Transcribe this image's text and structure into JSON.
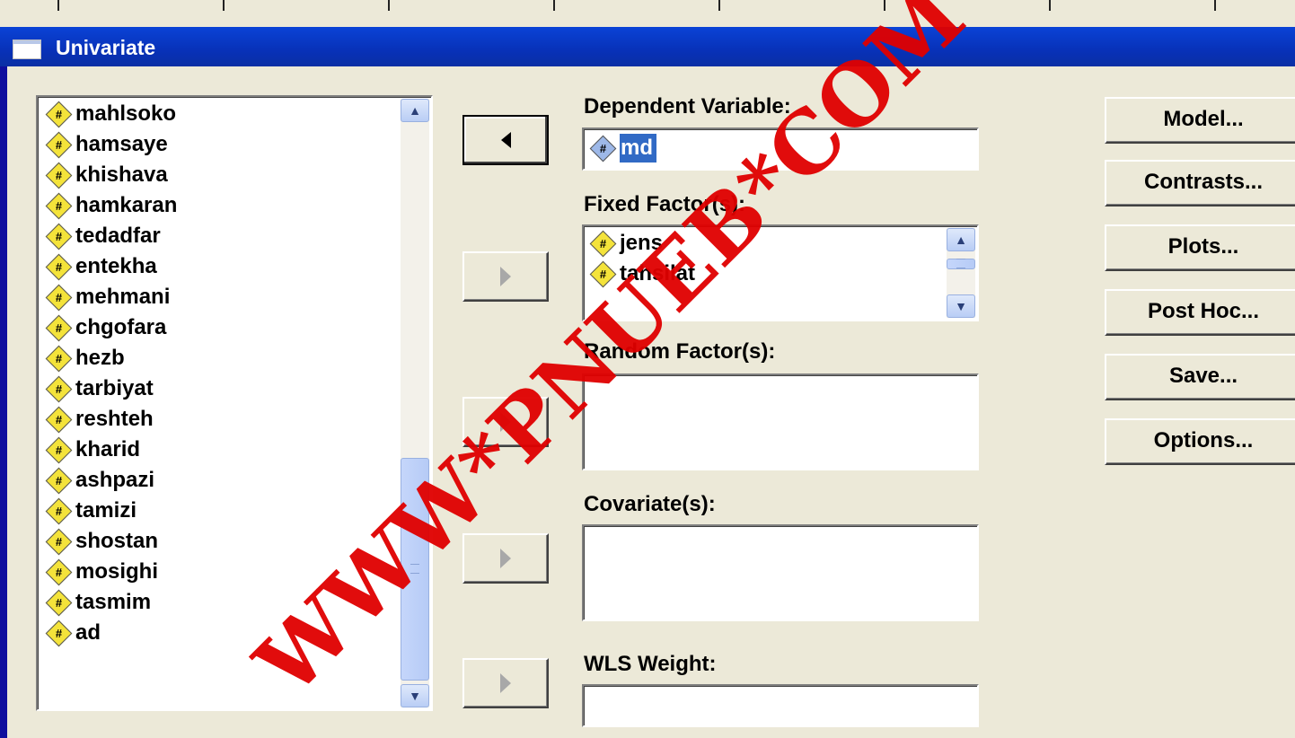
{
  "window": {
    "title": "Univariate"
  },
  "variables": [
    "mahlsoko",
    "hamsaye",
    "khishava",
    "hamkaran",
    "tedadfar",
    "entekha",
    "mehmani",
    "chgofara",
    "hezb",
    "tarbiyat",
    "reshteh",
    "kharid",
    "ashpazi",
    "tamizi",
    "shostan",
    "mosighi",
    "tasmim",
    "ad"
  ],
  "dependent": {
    "label": "Dependent Variable:",
    "value": "md"
  },
  "fixed": {
    "label": "Fixed Factor(s):",
    "items": [
      "jens",
      "tahsilat"
    ]
  },
  "random": {
    "label": "Random Factor(s):"
  },
  "covariates": {
    "label": "Covariate(s):"
  },
  "wls": {
    "label": "WLS Weight:"
  },
  "buttons": {
    "model": "Model...",
    "contrasts": "Contrasts...",
    "plots": "Plots...",
    "posthoc": "Post Hoc...",
    "save": "Save...",
    "options": "Options..."
  },
  "icons": {
    "variable": "scale-variable-icon",
    "move_left": "arrow-left-icon",
    "move_right": "arrow-right-icon"
  },
  "watermark": "WWW*PNUEB*COM",
  "colors": {
    "background": "#0f0f9e",
    "titlebar": "#0a3cc8",
    "dialog": "#ece9d8",
    "selection": "#316ac5",
    "watermark": "#e00000"
  }
}
